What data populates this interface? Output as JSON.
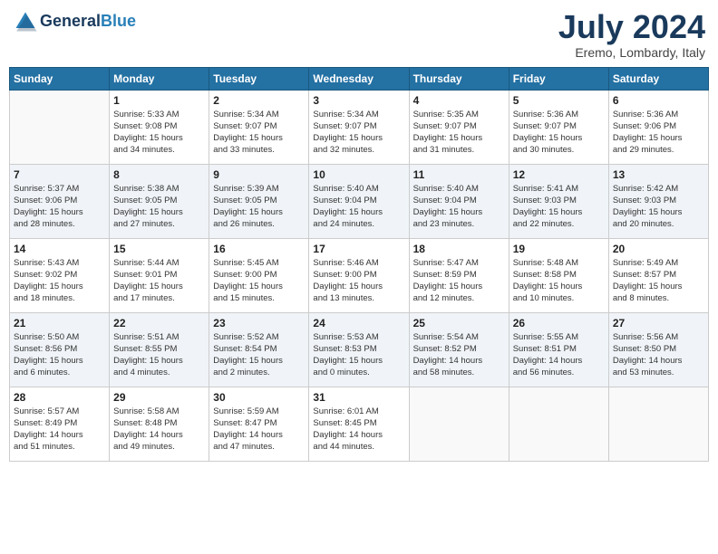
{
  "header": {
    "logo_line1": "General",
    "logo_line2": "Blue",
    "month_year": "July 2024",
    "location": "Eremo, Lombardy, Italy"
  },
  "weekdays": [
    "Sunday",
    "Monday",
    "Tuesday",
    "Wednesday",
    "Thursday",
    "Friday",
    "Saturday"
  ],
  "weeks": [
    [
      {
        "day": "",
        "sunrise": "",
        "sunset": "",
        "daylight": ""
      },
      {
        "day": "1",
        "sunrise": "Sunrise: 5:33 AM",
        "sunset": "Sunset: 9:08 PM",
        "daylight": "Daylight: 15 hours and 34 minutes."
      },
      {
        "day": "2",
        "sunrise": "Sunrise: 5:34 AM",
        "sunset": "Sunset: 9:07 PM",
        "daylight": "Daylight: 15 hours and 33 minutes."
      },
      {
        "day": "3",
        "sunrise": "Sunrise: 5:34 AM",
        "sunset": "Sunset: 9:07 PM",
        "daylight": "Daylight: 15 hours and 32 minutes."
      },
      {
        "day": "4",
        "sunrise": "Sunrise: 5:35 AM",
        "sunset": "Sunset: 9:07 PM",
        "daylight": "Daylight: 15 hours and 31 minutes."
      },
      {
        "day": "5",
        "sunrise": "Sunrise: 5:36 AM",
        "sunset": "Sunset: 9:07 PM",
        "daylight": "Daylight: 15 hours and 30 minutes."
      },
      {
        "day": "6",
        "sunrise": "Sunrise: 5:36 AM",
        "sunset": "Sunset: 9:06 PM",
        "daylight": "Daylight: 15 hours and 29 minutes."
      }
    ],
    [
      {
        "day": "7",
        "sunrise": "Sunrise: 5:37 AM",
        "sunset": "Sunset: 9:06 PM",
        "daylight": "Daylight: 15 hours and 28 minutes."
      },
      {
        "day": "8",
        "sunrise": "Sunrise: 5:38 AM",
        "sunset": "Sunset: 9:05 PM",
        "daylight": "Daylight: 15 hours and 27 minutes."
      },
      {
        "day": "9",
        "sunrise": "Sunrise: 5:39 AM",
        "sunset": "Sunset: 9:05 PM",
        "daylight": "Daylight: 15 hours and 26 minutes."
      },
      {
        "day": "10",
        "sunrise": "Sunrise: 5:40 AM",
        "sunset": "Sunset: 9:04 PM",
        "daylight": "Daylight: 15 hours and 24 minutes."
      },
      {
        "day": "11",
        "sunrise": "Sunrise: 5:40 AM",
        "sunset": "Sunset: 9:04 PM",
        "daylight": "Daylight: 15 hours and 23 minutes."
      },
      {
        "day": "12",
        "sunrise": "Sunrise: 5:41 AM",
        "sunset": "Sunset: 9:03 PM",
        "daylight": "Daylight: 15 hours and 22 minutes."
      },
      {
        "day": "13",
        "sunrise": "Sunrise: 5:42 AM",
        "sunset": "Sunset: 9:03 PM",
        "daylight": "Daylight: 15 hours and 20 minutes."
      }
    ],
    [
      {
        "day": "14",
        "sunrise": "Sunrise: 5:43 AM",
        "sunset": "Sunset: 9:02 PM",
        "daylight": "Daylight: 15 hours and 18 minutes."
      },
      {
        "day": "15",
        "sunrise": "Sunrise: 5:44 AM",
        "sunset": "Sunset: 9:01 PM",
        "daylight": "Daylight: 15 hours and 17 minutes."
      },
      {
        "day": "16",
        "sunrise": "Sunrise: 5:45 AM",
        "sunset": "Sunset: 9:00 PM",
        "daylight": "Daylight: 15 hours and 15 minutes."
      },
      {
        "day": "17",
        "sunrise": "Sunrise: 5:46 AM",
        "sunset": "Sunset: 9:00 PM",
        "daylight": "Daylight: 15 hours and 13 minutes."
      },
      {
        "day": "18",
        "sunrise": "Sunrise: 5:47 AM",
        "sunset": "Sunset: 8:59 PM",
        "daylight": "Daylight: 15 hours and 12 minutes."
      },
      {
        "day": "19",
        "sunrise": "Sunrise: 5:48 AM",
        "sunset": "Sunset: 8:58 PM",
        "daylight": "Daylight: 15 hours and 10 minutes."
      },
      {
        "day": "20",
        "sunrise": "Sunrise: 5:49 AM",
        "sunset": "Sunset: 8:57 PM",
        "daylight": "Daylight: 15 hours and 8 minutes."
      }
    ],
    [
      {
        "day": "21",
        "sunrise": "Sunrise: 5:50 AM",
        "sunset": "Sunset: 8:56 PM",
        "daylight": "Daylight: 15 hours and 6 minutes."
      },
      {
        "day": "22",
        "sunrise": "Sunrise: 5:51 AM",
        "sunset": "Sunset: 8:55 PM",
        "daylight": "Daylight: 15 hours and 4 minutes."
      },
      {
        "day": "23",
        "sunrise": "Sunrise: 5:52 AM",
        "sunset": "Sunset: 8:54 PM",
        "daylight": "Daylight: 15 hours and 2 minutes."
      },
      {
        "day": "24",
        "sunrise": "Sunrise: 5:53 AM",
        "sunset": "Sunset: 8:53 PM",
        "daylight": "Daylight: 15 hours and 0 minutes."
      },
      {
        "day": "25",
        "sunrise": "Sunrise: 5:54 AM",
        "sunset": "Sunset: 8:52 PM",
        "daylight": "Daylight: 14 hours and 58 minutes."
      },
      {
        "day": "26",
        "sunrise": "Sunrise: 5:55 AM",
        "sunset": "Sunset: 8:51 PM",
        "daylight": "Daylight: 14 hours and 56 minutes."
      },
      {
        "day": "27",
        "sunrise": "Sunrise: 5:56 AM",
        "sunset": "Sunset: 8:50 PM",
        "daylight": "Daylight: 14 hours and 53 minutes."
      }
    ],
    [
      {
        "day": "28",
        "sunrise": "Sunrise: 5:57 AM",
        "sunset": "Sunset: 8:49 PM",
        "daylight": "Daylight: 14 hours and 51 minutes."
      },
      {
        "day": "29",
        "sunrise": "Sunrise: 5:58 AM",
        "sunset": "Sunset: 8:48 PM",
        "daylight": "Daylight: 14 hours and 49 minutes."
      },
      {
        "day": "30",
        "sunrise": "Sunrise: 5:59 AM",
        "sunset": "Sunset: 8:47 PM",
        "daylight": "Daylight: 14 hours and 47 minutes."
      },
      {
        "day": "31",
        "sunrise": "Sunrise: 6:01 AM",
        "sunset": "Sunset: 8:45 PM",
        "daylight": "Daylight: 14 hours and 44 minutes."
      },
      {
        "day": "",
        "sunrise": "",
        "sunset": "",
        "daylight": ""
      },
      {
        "day": "",
        "sunrise": "",
        "sunset": "",
        "daylight": ""
      },
      {
        "day": "",
        "sunrise": "",
        "sunset": "",
        "daylight": ""
      }
    ]
  ]
}
